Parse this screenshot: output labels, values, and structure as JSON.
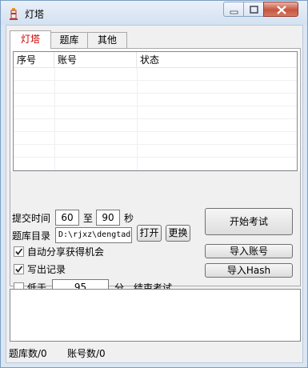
{
  "window": {
    "title": "灯塔"
  },
  "tabs": [
    {
      "label": "灯塔"
    },
    {
      "label": "题库"
    },
    {
      "label": "其他"
    }
  ],
  "table": {
    "columns": [
      "序号",
      "账号",
      "状态"
    ],
    "rows": []
  },
  "form": {
    "submit_time_label": "提交时间",
    "submit_min": "60",
    "to_label": "至",
    "submit_max": "90",
    "seconds_label": "秒",
    "dir_label": "题库目录",
    "dir_value": "D:\\rjxz\\dengtadati",
    "open_button": "打开",
    "change_button": "更换",
    "auto_share_label": "自动分享获得机会",
    "auto_share_checked": true,
    "write_log_label": "写出记录",
    "write_log_checked": true,
    "below_label": "低于",
    "below_checked": false,
    "below_value": "95",
    "below_suffix": "分，结束考试"
  },
  "actions": {
    "start_exam": "开始考试",
    "import_accounts": "导入账号",
    "import_hash": "导入Hash"
  },
  "status": {
    "question_count": "题库数/0",
    "account_count": "账号数/0"
  },
  "colors": {
    "active_tab_text": "#d00000",
    "window_frame": "#dbe6f3",
    "close_button": "#c6553e"
  }
}
